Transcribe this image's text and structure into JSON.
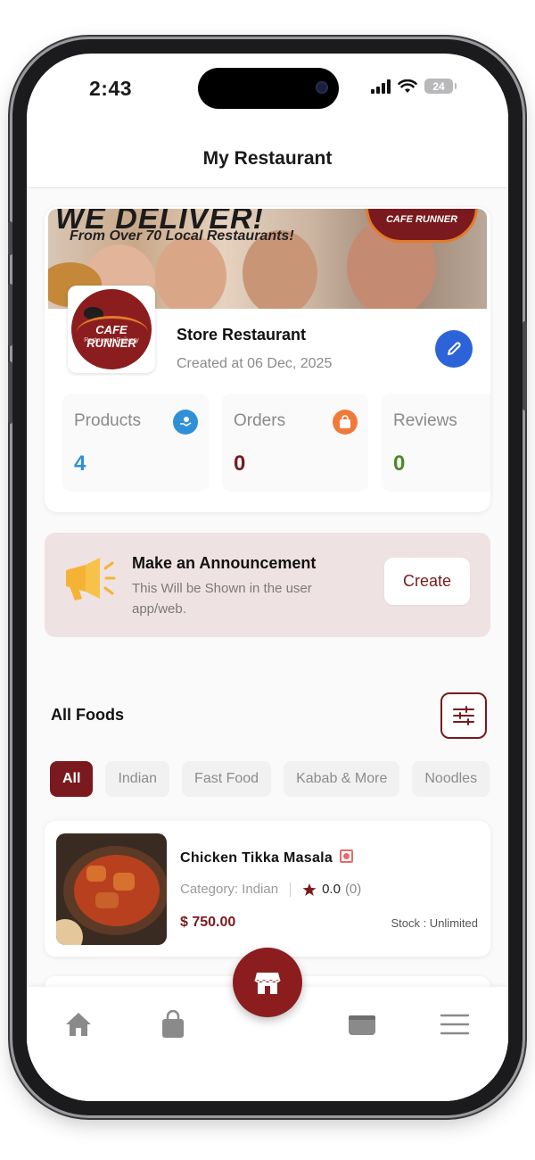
{
  "status_bar": {
    "time": "2:43",
    "battery": "24"
  },
  "header": {
    "title": "My Restaurant"
  },
  "banner": {
    "headline": "WE DELIVER!",
    "subline": "From Over 70 Local Restaurants!",
    "logo_text": "CAFE RUNNER"
  },
  "store": {
    "logo_name": "CAFE RUNNER",
    "logo_sub": "Restaurant Delivery",
    "name": "Store Restaurant",
    "created": "Created at 06 Dec, 2025"
  },
  "stats": [
    {
      "label": "Products",
      "value": "4",
      "color": "#2f8fd8"
    },
    {
      "label": "Orders",
      "value": "0",
      "color": "#7a1a1e"
    },
    {
      "label": "Reviews",
      "value": "0",
      "color": "#4a8a2a"
    }
  ],
  "announcement": {
    "title": "Make an Announcement",
    "description": "This Will be Shown in the user app/web.",
    "button": "Create"
  },
  "foods_section": {
    "title": "All Foods",
    "categories": [
      "All",
      "Indian",
      "Fast Food",
      "Kabab & More",
      "Noodles"
    ],
    "active_category": "All"
  },
  "food_items": [
    {
      "name": "Chicken Tikka Masala",
      "category": "Category: Indian",
      "rating": "0.0",
      "rating_count": "(0)",
      "price": "$ 750.00",
      "stock": "Stock : Unlimited"
    }
  ],
  "nav": {
    "items": [
      "home-icon",
      "bag-icon",
      "store-icon",
      "wallet-icon",
      "menu-icon"
    ]
  },
  "colors": {
    "brand": "#7a1a1e",
    "accent_blue": "#2d63d8",
    "announce_bg": "#efe2e2"
  }
}
